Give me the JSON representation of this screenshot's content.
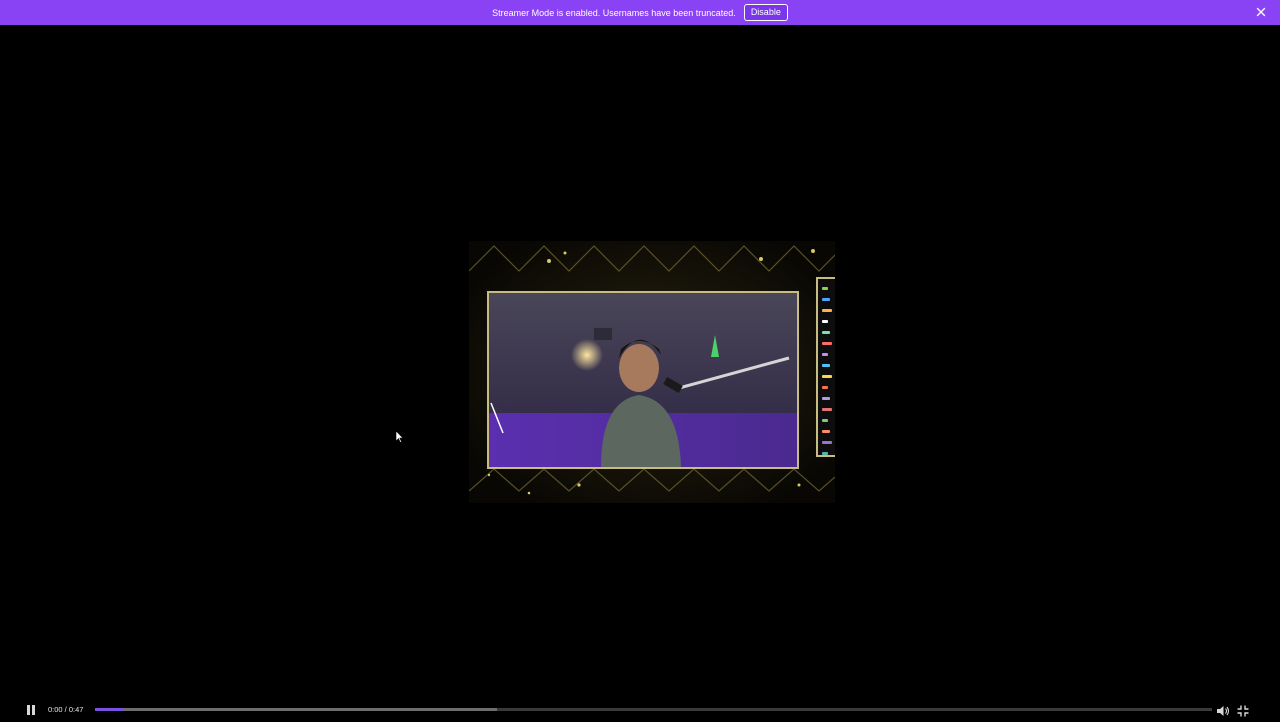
{
  "banner": {
    "message": "Streamer Mode is enabled. Usernames have been truncated.",
    "disable_label": "Disable",
    "close_icon": "close-icon",
    "color": "#8a42f5"
  },
  "video": {
    "frame_color": "#c9bc82",
    "chat_colors": [
      "#8fd14f",
      "#4fa3ff",
      "#ffb347",
      "#ffffff",
      "#7ee0a6",
      "#ff6b6b",
      "#c38bff",
      "#4fc3f7",
      "#ffd54f",
      "#ff7043",
      "#b39ddb",
      "#e57373",
      "#81c784",
      "#ff8a65",
      "#9575cd",
      "#4db6ac"
    ]
  },
  "player": {
    "time": "0:00 / 0:47",
    "progress_fraction": 0.025,
    "buffered_fraction": 0.36,
    "accent_color": "#7b4fe0",
    "play_state_icon": "pause-icon",
    "volume_icon": "volume-icon",
    "fullscreen_icon": "exit-fullscreen-icon"
  }
}
